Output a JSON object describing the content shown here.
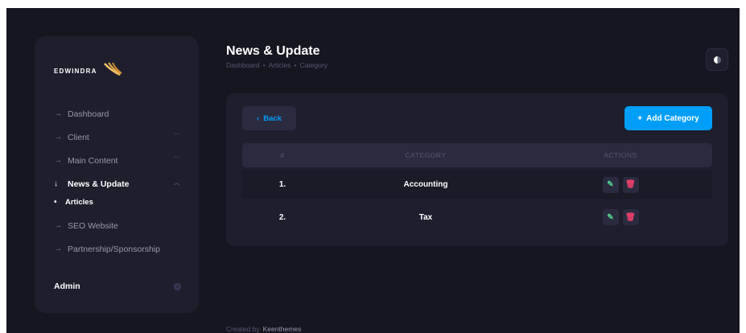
{
  "brand": {
    "name": "EDWINDRA",
    "accent": "#f5c36a"
  },
  "sidebar": {
    "items": [
      {
        "label": "Dashboard",
        "arrow": "→",
        "chevron": ""
      },
      {
        "label": "Client",
        "arrow": "→",
        "chevron": "﹀"
      },
      {
        "label": "Main Content",
        "arrow": "→",
        "chevron": "﹀"
      },
      {
        "label": "News & Update",
        "arrow": "↓",
        "chevron": "︿"
      },
      {
        "label": "SEO Website",
        "arrow": "→",
        "chevron": ""
      },
      {
        "label": "Partnership/Sponsorship",
        "arrow": "→",
        "chevron": ""
      }
    ],
    "sub_item": {
      "label": "Articles",
      "dot": "•"
    },
    "user": "Admin"
  },
  "header": {
    "title": "News & Update",
    "breadcrumb": [
      "Dashboard",
      "•",
      "Articles",
      "•",
      "Category"
    ]
  },
  "toolbar": {
    "back_label": "Back",
    "back_icon": "‹",
    "add_label": "Add Category",
    "add_icon": "+"
  },
  "table": {
    "headers": [
      "#",
      "CATEGORY",
      "ACTIONS"
    ],
    "rows": [
      {
        "num": "1.",
        "category": "Accounting"
      },
      {
        "num": "2.",
        "category": "Tax"
      }
    ],
    "edit_icon": "✎",
    "delete_icon": "🗑"
  },
  "footer": {
    "text": "Created by",
    "link": "Keenthemes"
  },
  "colors": {
    "primary": "#009ef7",
    "success": "#50cd89",
    "danger": "#f1416c",
    "background": "#161621",
    "panel": "#1e1e2d"
  }
}
